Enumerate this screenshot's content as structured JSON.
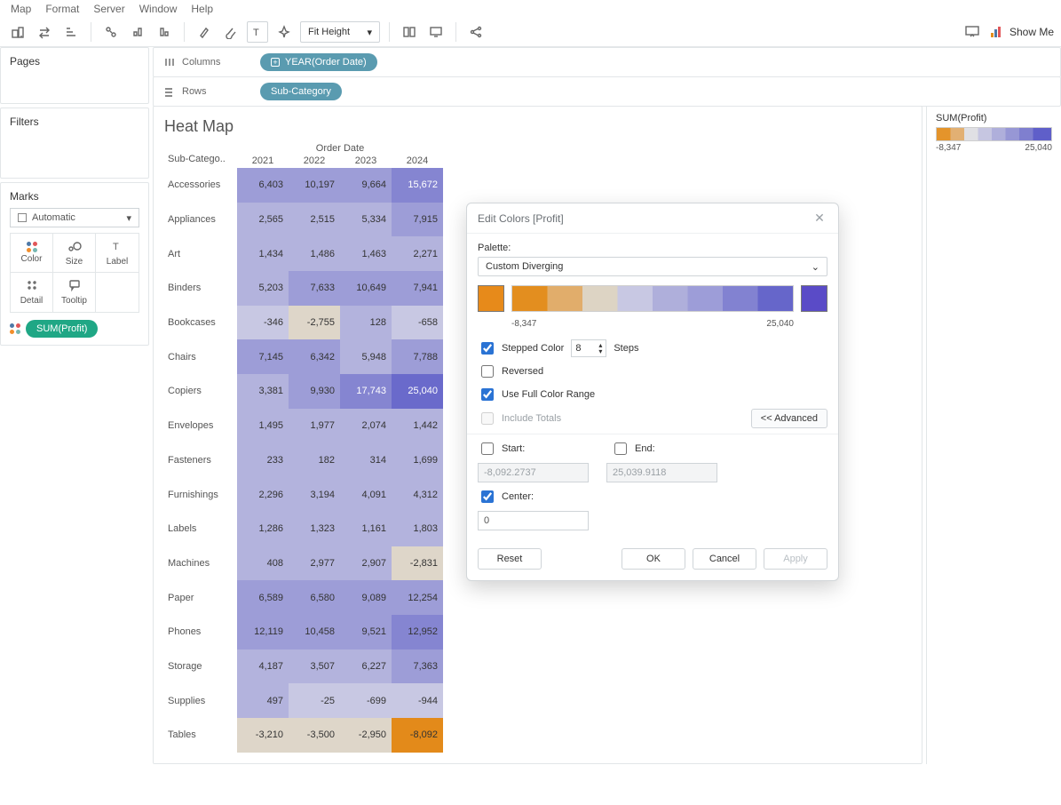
{
  "menu": {
    "items": [
      "Map",
      "Format",
      "Server",
      "Window",
      "Help"
    ]
  },
  "toolbar": {
    "fit_label": "Fit Height",
    "show_me": "Show Me"
  },
  "shelves": {
    "columns_label": "Columns",
    "rows_label": "Rows",
    "col_pill": "YEAR(Order Date)",
    "row_pill": "Sub-Category"
  },
  "panels": {
    "pages": "Pages",
    "filters": "Filters",
    "marks": "Marks",
    "marks_type": "Automatic",
    "marks_cells": [
      "Color",
      "Size",
      "Label",
      "Detail",
      "Tooltip"
    ],
    "sum_pill": "SUM(Profit)"
  },
  "viz": {
    "title": "Heat Map",
    "col_header": "Order Date",
    "corner": "Sub-Catego.."
  },
  "legend": {
    "title": "SUM(Profit)",
    "min": "-8,347",
    "max": "25,040"
  },
  "dialog": {
    "title": "Edit Colors [Profit]",
    "palette_label": "Palette:",
    "palette_value": "Custom Diverging",
    "min": "-8,347",
    "max": "25,040",
    "stepped": "Stepped Color",
    "steps_value": "8",
    "steps_word": "Steps",
    "reversed": "Reversed",
    "full_range": "Use Full Color Range",
    "include_totals": "Include Totals",
    "advanced": "<< Advanced",
    "start": "Start:",
    "end": "End:",
    "start_val": "-8,092.2737",
    "end_val": "25,039.9118",
    "center": "Center:",
    "center_val": "0",
    "reset": "Reset",
    "ok": "OK",
    "cancel": "Cancel",
    "apply": "Apply"
  },
  "chart_data": {
    "type": "heatmap",
    "title": "Heat Map",
    "xlabel": "Order Date",
    "ylabel": "Sub-Category",
    "years": [
      "2021",
      "2022",
      "2023",
      "2024"
    ],
    "rows": [
      "Accessories",
      "Appliances",
      "Art",
      "Binders",
      "Bookcases",
      "Chairs",
      "Copiers",
      "Envelopes",
      "Fasteners",
      "Furnishings",
      "Labels",
      "Machines",
      "Paper",
      "Phones",
      "Storage",
      "Supplies",
      "Tables"
    ],
    "values": [
      [
        6403,
        10197,
        9664,
        15672
      ],
      [
        2565,
        2515,
        5334,
        7915
      ],
      [
        1434,
        1486,
        1463,
        2271
      ],
      [
        5203,
        7633,
        10649,
        7941
      ],
      [
        -346,
        -2755,
        128,
        -658
      ],
      [
        7145,
        6342,
        5948,
        7788
      ],
      [
        3381,
        9930,
        17743,
        25040
      ],
      [
        1495,
        1977,
        2074,
        1442
      ],
      [
        233,
        182,
        314,
        1699
      ],
      [
        2296,
        3194,
        4091,
        4312
      ],
      [
        1286,
        1323,
        1161,
        1803
      ],
      [
        408,
        2977,
        2907,
        -2831
      ],
      [
        6589,
        6580,
        9089,
        12254
      ],
      [
        12119,
        10458,
        9521,
        12952
      ],
      [
        4187,
        3507,
        6227,
        7363
      ],
      [
        497,
        -25,
        -699,
        -944
      ],
      [
        -3210,
        -3500,
        -2950,
        -8092
      ]
    ],
    "color_min": -8347,
    "color_max": 25040,
    "color_center": 0,
    "palette": "Custom Diverging",
    "steps": 8
  }
}
